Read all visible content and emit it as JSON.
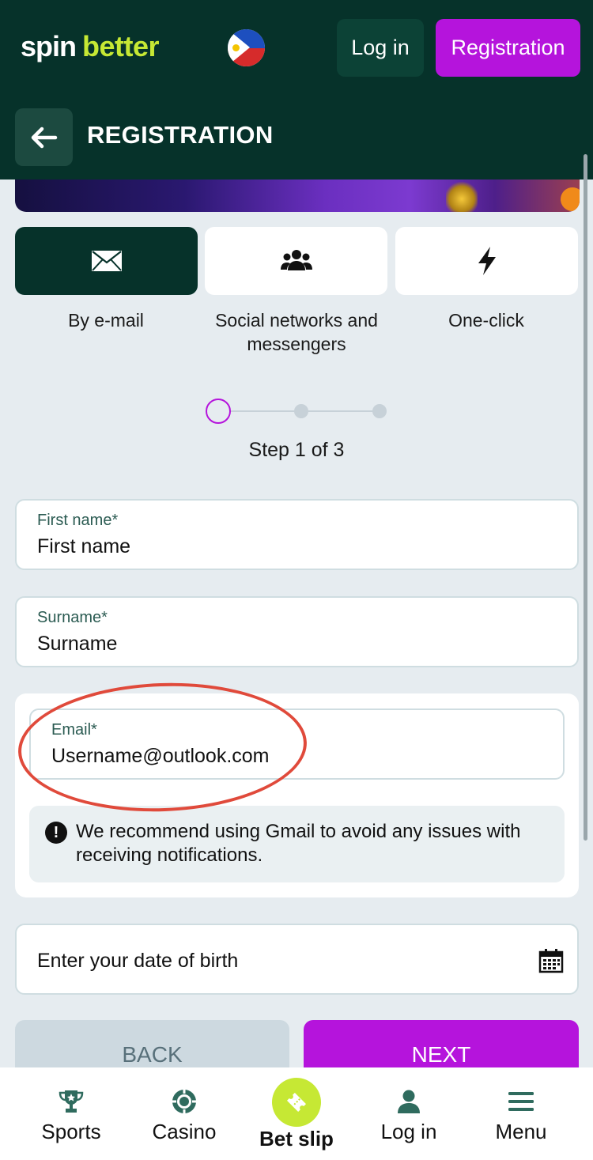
{
  "header": {
    "logo_spin": "spin",
    "logo_better": "better",
    "login_label": "Log in",
    "registration_label": "Registration"
  },
  "subheader": {
    "title": "REGISTRATION"
  },
  "tabs": [
    {
      "label": "By e-mail",
      "icon": "envelope-icon",
      "active": true
    },
    {
      "label": "Social networks and messengers",
      "icon": "users-icon",
      "active": false
    },
    {
      "label": "One-click",
      "icon": "lightning-icon",
      "active": false
    }
  ],
  "stepper": {
    "text": "Step 1 of 3",
    "current": 1,
    "total": 3
  },
  "form": {
    "first_name": {
      "label": "First name*",
      "placeholder": "First name"
    },
    "surname": {
      "label": "Surname*",
      "placeholder": "Surname"
    },
    "email": {
      "label": "Email*",
      "value": "Username@outlook.com"
    },
    "notice": "We recommend using Gmail to avoid any issues with receiving notifications.",
    "dob": {
      "placeholder": "Enter your date of birth"
    },
    "back_label": "BACK",
    "next_label": "NEXT"
  },
  "bottom_nav": {
    "sports": "Sports",
    "casino": "Casino",
    "betslip": "Bet slip",
    "login": "Log in",
    "menu": "Menu"
  },
  "colors": {
    "header_bg": "#06322a",
    "accent_purple": "#b514dc",
    "accent_lime": "#c6e834",
    "page_bg": "#e6ecf0",
    "highlight_red": "#e04a3b"
  }
}
